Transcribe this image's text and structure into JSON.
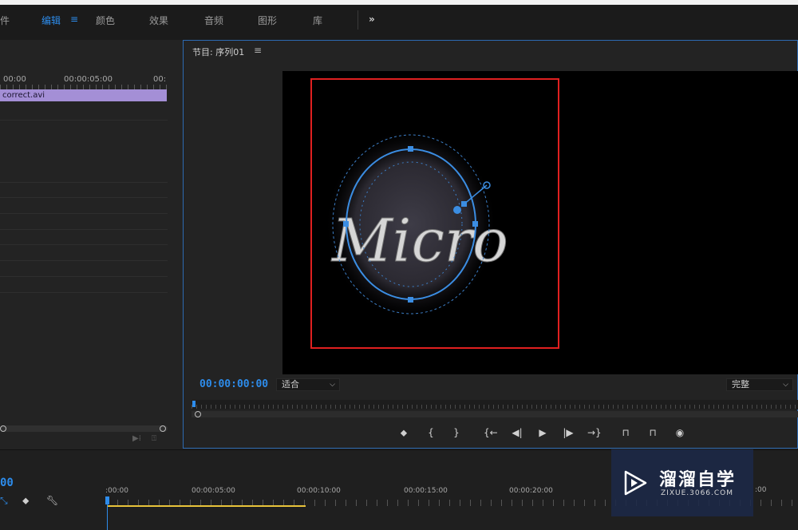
{
  "workspace_tabs": [
    {
      "label": "件"
    },
    {
      "label": "编辑",
      "active": true
    },
    {
      "label": "≡"
    },
    {
      "label": "颜色"
    },
    {
      "label": "效果"
    },
    {
      "label": "音频"
    },
    {
      "label": "图形"
    },
    {
      "label": "库"
    },
    {
      "label": "»"
    }
  ],
  "source_panel": {
    "ruler_labels": [
      "00:00",
      "00:00:05:00",
      "00:"
    ],
    "clip_name": "correct.avi"
  },
  "program_monitor": {
    "title": "节目: 序列01",
    "menu_icon": "≡",
    "video_text": "Micro",
    "timecode": "00:00:00:00",
    "fit_value": "适合",
    "quality_value": "完整",
    "controls": [
      "marker-icon",
      "mark-in-icon",
      "mark-out-icon",
      "go-to-in-icon",
      "step-back-icon",
      "play-icon",
      "step-forward-icon",
      "go-to-out-icon",
      "lift-icon",
      "extract-icon",
      "camera-icon"
    ],
    "control_glyphs": [
      "⬥",
      "{",
      "}",
      "{←",
      "◀|",
      "▶",
      "|▶",
      "→}",
      "⊓",
      "⊓",
      "◉"
    ]
  },
  "timeline": {
    "timecode": "00",
    "ruler_labels": [
      ":00:00",
      "00:00:05:00",
      "00:00:10:00",
      "00:00:15:00",
      "00:00:20:00",
      ":00"
    ]
  },
  "watermark": {
    "title": "溜溜自学",
    "subtitle": "ZIXUE.3066.COM"
  },
  "colors": {
    "accent": "#2d8ceb",
    "clip": "#a48fd6",
    "selection_box": "#e02020",
    "in_out_bar": "#e8c33a"
  }
}
